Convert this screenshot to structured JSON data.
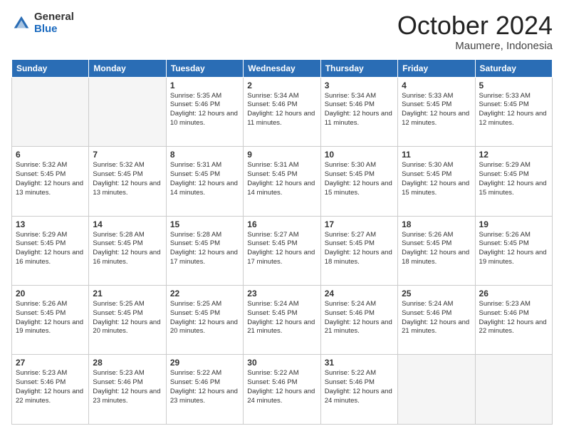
{
  "logo": {
    "general": "General",
    "blue": "Blue"
  },
  "header": {
    "month": "October 2024",
    "location": "Maumere, Indonesia"
  },
  "weekdays": [
    "Sunday",
    "Monday",
    "Tuesday",
    "Wednesday",
    "Thursday",
    "Friday",
    "Saturday"
  ],
  "weeks": [
    [
      {
        "day": "",
        "info": ""
      },
      {
        "day": "",
        "info": ""
      },
      {
        "day": "1",
        "sunrise": "Sunrise: 5:35 AM",
        "sunset": "Sunset: 5:46 PM",
        "daylight": "Daylight: 12 hours and 10 minutes."
      },
      {
        "day": "2",
        "sunrise": "Sunrise: 5:34 AM",
        "sunset": "Sunset: 5:46 PM",
        "daylight": "Daylight: 12 hours and 11 minutes."
      },
      {
        "day": "3",
        "sunrise": "Sunrise: 5:34 AM",
        "sunset": "Sunset: 5:46 PM",
        "daylight": "Daylight: 12 hours and 11 minutes."
      },
      {
        "day": "4",
        "sunrise": "Sunrise: 5:33 AM",
        "sunset": "Sunset: 5:45 PM",
        "daylight": "Daylight: 12 hours and 12 minutes."
      },
      {
        "day": "5",
        "sunrise": "Sunrise: 5:33 AM",
        "sunset": "Sunset: 5:45 PM",
        "daylight": "Daylight: 12 hours and 12 minutes."
      }
    ],
    [
      {
        "day": "6",
        "sunrise": "Sunrise: 5:32 AM",
        "sunset": "Sunset: 5:45 PM",
        "daylight": "Daylight: 12 hours and 13 minutes."
      },
      {
        "day": "7",
        "sunrise": "Sunrise: 5:32 AM",
        "sunset": "Sunset: 5:45 PM",
        "daylight": "Daylight: 12 hours and 13 minutes."
      },
      {
        "day": "8",
        "sunrise": "Sunrise: 5:31 AM",
        "sunset": "Sunset: 5:45 PM",
        "daylight": "Daylight: 12 hours and 14 minutes."
      },
      {
        "day": "9",
        "sunrise": "Sunrise: 5:31 AM",
        "sunset": "Sunset: 5:45 PM",
        "daylight": "Daylight: 12 hours and 14 minutes."
      },
      {
        "day": "10",
        "sunrise": "Sunrise: 5:30 AM",
        "sunset": "Sunset: 5:45 PM",
        "daylight": "Daylight: 12 hours and 15 minutes."
      },
      {
        "day": "11",
        "sunrise": "Sunrise: 5:30 AM",
        "sunset": "Sunset: 5:45 PM",
        "daylight": "Daylight: 12 hours and 15 minutes."
      },
      {
        "day": "12",
        "sunrise": "Sunrise: 5:29 AM",
        "sunset": "Sunset: 5:45 PM",
        "daylight": "Daylight: 12 hours and 15 minutes."
      }
    ],
    [
      {
        "day": "13",
        "sunrise": "Sunrise: 5:29 AM",
        "sunset": "Sunset: 5:45 PM",
        "daylight": "Daylight: 12 hours and 16 minutes."
      },
      {
        "day": "14",
        "sunrise": "Sunrise: 5:28 AM",
        "sunset": "Sunset: 5:45 PM",
        "daylight": "Daylight: 12 hours and 16 minutes."
      },
      {
        "day": "15",
        "sunrise": "Sunrise: 5:28 AM",
        "sunset": "Sunset: 5:45 PM",
        "daylight": "Daylight: 12 hours and 17 minutes."
      },
      {
        "day": "16",
        "sunrise": "Sunrise: 5:27 AM",
        "sunset": "Sunset: 5:45 PM",
        "daylight": "Daylight: 12 hours and 17 minutes."
      },
      {
        "day": "17",
        "sunrise": "Sunrise: 5:27 AM",
        "sunset": "Sunset: 5:45 PM",
        "daylight": "Daylight: 12 hours and 18 minutes."
      },
      {
        "day": "18",
        "sunrise": "Sunrise: 5:26 AM",
        "sunset": "Sunset: 5:45 PM",
        "daylight": "Daylight: 12 hours and 18 minutes."
      },
      {
        "day": "19",
        "sunrise": "Sunrise: 5:26 AM",
        "sunset": "Sunset: 5:45 PM",
        "daylight": "Daylight: 12 hours and 19 minutes."
      }
    ],
    [
      {
        "day": "20",
        "sunrise": "Sunrise: 5:26 AM",
        "sunset": "Sunset: 5:45 PM",
        "daylight": "Daylight: 12 hours and 19 minutes."
      },
      {
        "day": "21",
        "sunrise": "Sunrise: 5:25 AM",
        "sunset": "Sunset: 5:45 PM",
        "daylight": "Daylight: 12 hours and 20 minutes."
      },
      {
        "day": "22",
        "sunrise": "Sunrise: 5:25 AM",
        "sunset": "Sunset: 5:45 PM",
        "daylight": "Daylight: 12 hours and 20 minutes."
      },
      {
        "day": "23",
        "sunrise": "Sunrise: 5:24 AM",
        "sunset": "Sunset: 5:45 PM",
        "daylight": "Daylight: 12 hours and 21 minutes."
      },
      {
        "day": "24",
        "sunrise": "Sunrise: 5:24 AM",
        "sunset": "Sunset: 5:46 PM",
        "daylight": "Daylight: 12 hours and 21 minutes."
      },
      {
        "day": "25",
        "sunrise": "Sunrise: 5:24 AM",
        "sunset": "Sunset: 5:46 PM",
        "daylight": "Daylight: 12 hours and 21 minutes."
      },
      {
        "day": "26",
        "sunrise": "Sunrise: 5:23 AM",
        "sunset": "Sunset: 5:46 PM",
        "daylight": "Daylight: 12 hours and 22 minutes."
      }
    ],
    [
      {
        "day": "27",
        "sunrise": "Sunrise: 5:23 AM",
        "sunset": "Sunset: 5:46 PM",
        "daylight": "Daylight: 12 hours and 22 minutes."
      },
      {
        "day": "28",
        "sunrise": "Sunrise: 5:23 AM",
        "sunset": "Sunset: 5:46 PM",
        "daylight": "Daylight: 12 hours and 23 minutes."
      },
      {
        "day": "29",
        "sunrise": "Sunrise: 5:22 AM",
        "sunset": "Sunset: 5:46 PM",
        "daylight": "Daylight: 12 hours and 23 minutes."
      },
      {
        "day": "30",
        "sunrise": "Sunrise: 5:22 AM",
        "sunset": "Sunset: 5:46 PM",
        "daylight": "Daylight: 12 hours and 24 minutes."
      },
      {
        "day": "31",
        "sunrise": "Sunrise: 5:22 AM",
        "sunset": "Sunset: 5:46 PM",
        "daylight": "Daylight: 12 hours and 24 minutes."
      },
      {
        "day": "",
        "info": ""
      },
      {
        "day": "",
        "info": ""
      }
    ]
  ]
}
